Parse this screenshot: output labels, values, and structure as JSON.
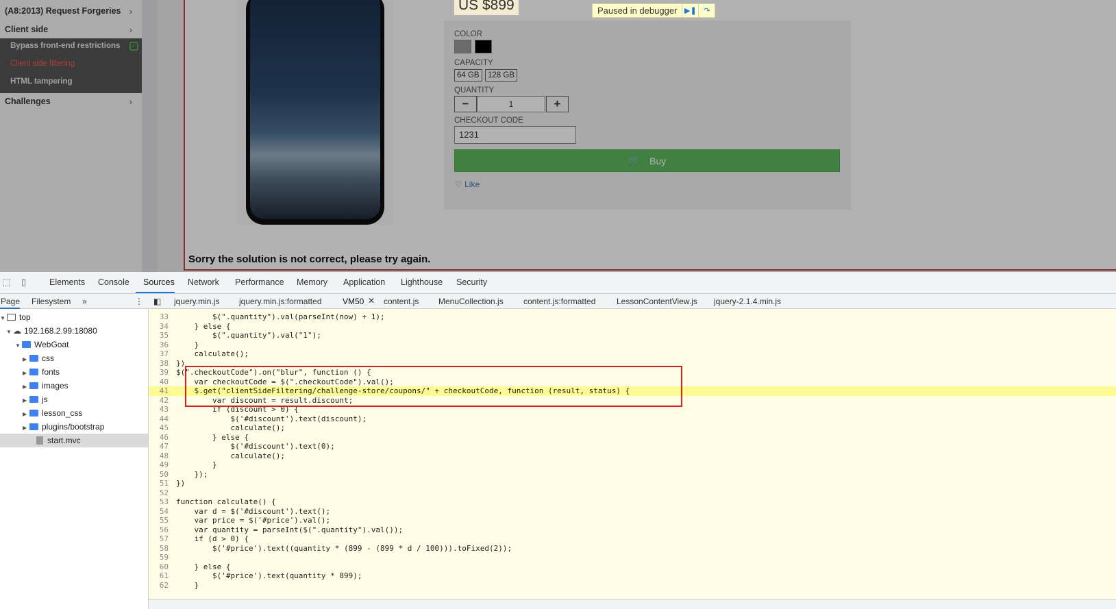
{
  "left_menu": {
    "items": [
      {
        "label": "(A8:2013) Request Forgeries"
      },
      {
        "label": "Client side"
      },
      {
        "label": "Challenges"
      }
    ],
    "chevron": "›",
    "submenu": [
      {
        "label": "Bypass front-end restrictions",
        "completed": true
      },
      {
        "label": "Client side filtering",
        "active": true
      },
      {
        "label": "HTML tampering"
      }
    ]
  },
  "product": {
    "price": "US $899",
    "color_label": "COLOR",
    "colors": [
      "#9a9a9a",
      "#000000"
    ],
    "capacity_label": "CAPACITY",
    "capacities": [
      "64 GB",
      "128 GB"
    ],
    "quantity_label": "QUANTITY",
    "quantity_minus": "−",
    "quantity": "1",
    "quantity_plus": "+",
    "checkout_label": "CHECKOUT CODE",
    "checkout_code": "1231",
    "buy_label": "Buy",
    "like_label": "Like",
    "feedback": "Sorry the solution is not correct, please try again."
  },
  "debugger_banner": {
    "text": "Paused in debugger",
    "resume_icon": "resume-icon",
    "step_over_icon": "step-over-icon"
  },
  "devtools": {
    "main_tabs": [
      "Elements",
      "Console",
      "Sources",
      "Network",
      "Performance",
      "Memory",
      "Application",
      "Lighthouse",
      "Security"
    ],
    "active_main_tab": "Sources",
    "navigator_tabs": [
      "Page",
      "Filesystem"
    ],
    "navigator_more": "»",
    "file_tree": {
      "top": "top",
      "host": "192.168.2.99:18080",
      "root": "WebGoat",
      "folders": [
        "css",
        "fonts",
        "images",
        "js",
        "lesson_css",
        "plugins/bootstrap"
      ],
      "selected_file": "start.mvc"
    },
    "file_tabs": [
      "jquery.min.js",
      "jquery.min.js:formatted",
      "VM50",
      "content.js",
      "MenuCollection.js",
      "content.js:formatted",
      "LessonContentView.js",
      "jquery-2.1.4.min.js"
    ],
    "active_file_tab": "VM50",
    "close_icon": "✕",
    "paused_line": 41,
    "code_lines": [
      {
        "n": "33",
        "text": "        $(\".quantity\").val(parseInt(now) + 1);"
      },
      {
        "n": "34",
        "text": "    } else {"
      },
      {
        "n": "35",
        "text": "        $(\".quantity\").val(\"1\");"
      },
      {
        "n": "36",
        "text": "    }"
      },
      {
        "n": "37",
        "text": "    calculate();"
      },
      {
        "n": "38",
        "text": "})"
      },
      {
        "n": "39",
        "text": "$(\".checkoutCode\").on(\"blur\", function () {"
      },
      {
        "n": "40",
        "text": "    var checkoutCode = $(\".checkoutCode\").val();"
      },
      {
        "n": "41",
        "text": "    $.get(\"clientSideFiltering/challenge-store/coupons/\" + checkoutCode, function (result, status) {"
      },
      {
        "n": "42",
        "text": "        var discount = result.discount;"
      },
      {
        "n": "43",
        "text": "        if (discount > 0) {"
      },
      {
        "n": "44",
        "text": "            $('#discount').text(discount);"
      },
      {
        "n": "45",
        "text": "            calculate();"
      },
      {
        "n": "46",
        "text": "        } else {"
      },
      {
        "n": "47",
        "text": "            $('#discount').text(0);"
      },
      {
        "n": "48",
        "text": "            calculate();"
      },
      {
        "n": "49",
        "text": "        }"
      },
      {
        "n": "50",
        "text": "    });"
      },
      {
        "n": "51",
        "text": "})"
      },
      {
        "n": "52",
        "text": ""
      },
      {
        "n": "53",
        "text": "function calculate() {"
      },
      {
        "n": "54",
        "text": "    var d = $('#discount').text();"
      },
      {
        "n": "55",
        "text": "    var price = $('#price').val();"
      },
      {
        "n": "56",
        "text": "    var quantity = parseInt($(\".quantity\").val());"
      },
      {
        "n": "57",
        "text": "    if (d > 0) {"
      },
      {
        "n": "58",
        "text": "        $('#price').text((quantity * (899 - (899 * d / 100))).toFixed(2));"
      },
      {
        "n": "59",
        "text": ""
      },
      {
        "n": "60",
        "text": "    } else {"
      },
      {
        "n": "61",
        "text": "        $('#price').text(quantity * 899);"
      },
      {
        "n": "62",
        "text": "    }"
      }
    ]
  },
  "colors": {
    "accent": "#1a73e8",
    "buy_green": "#5cb85c",
    "highlight_box": "#e21b1b",
    "paused_line_bg": "#fdfc92"
  }
}
